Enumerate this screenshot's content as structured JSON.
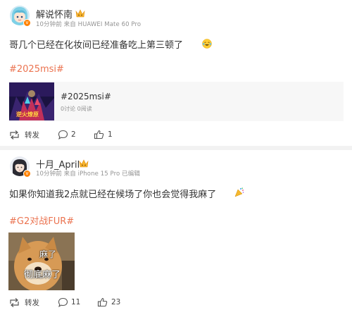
{
  "posts": [
    {
      "user_name": "解说怀南",
      "meta": "10分钟前 来自 HUAWEI Mate 60 Pro",
      "text": "哥几个已经在化妆间已经准备吃上第三顿了",
      "emoji_icon": "crying-laughing-emoji-icon",
      "hashtag": "#2025msi#",
      "topic_card": {
        "title": "#2025msi#",
        "stats": "0讨论 0阅读",
        "thumb_text": "逆火燎原"
      },
      "actions": {
        "forward": "转发",
        "comments": "2",
        "likes": "1"
      }
    },
    {
      "user_name": "十月_April",
      "meta": "10分钟前 来自 iPhone 15 Pro 已编辑",
      "text": "如果你知道我2点就已经在候场了你也会觉得我麻了",
      "emoji_icon": "confetti-emoji-icon",
      "hashtag": "#G2对战FUR#",
      "meme": {
        "line1": "麻了",
        "line2": "彻底麻了"
      },
      "actions": {
        "forward": "转发",
        "comments": "11",
        "likes": "23"
      }
    }
  ],
  "colors": {
    "hashtag": "#eb7350",
    "meta": "#939393",
    "separator": "#f2f2f2",
    "card_bg": "#f7f7f7",
    "badge": "#ff8200"
  }
}
